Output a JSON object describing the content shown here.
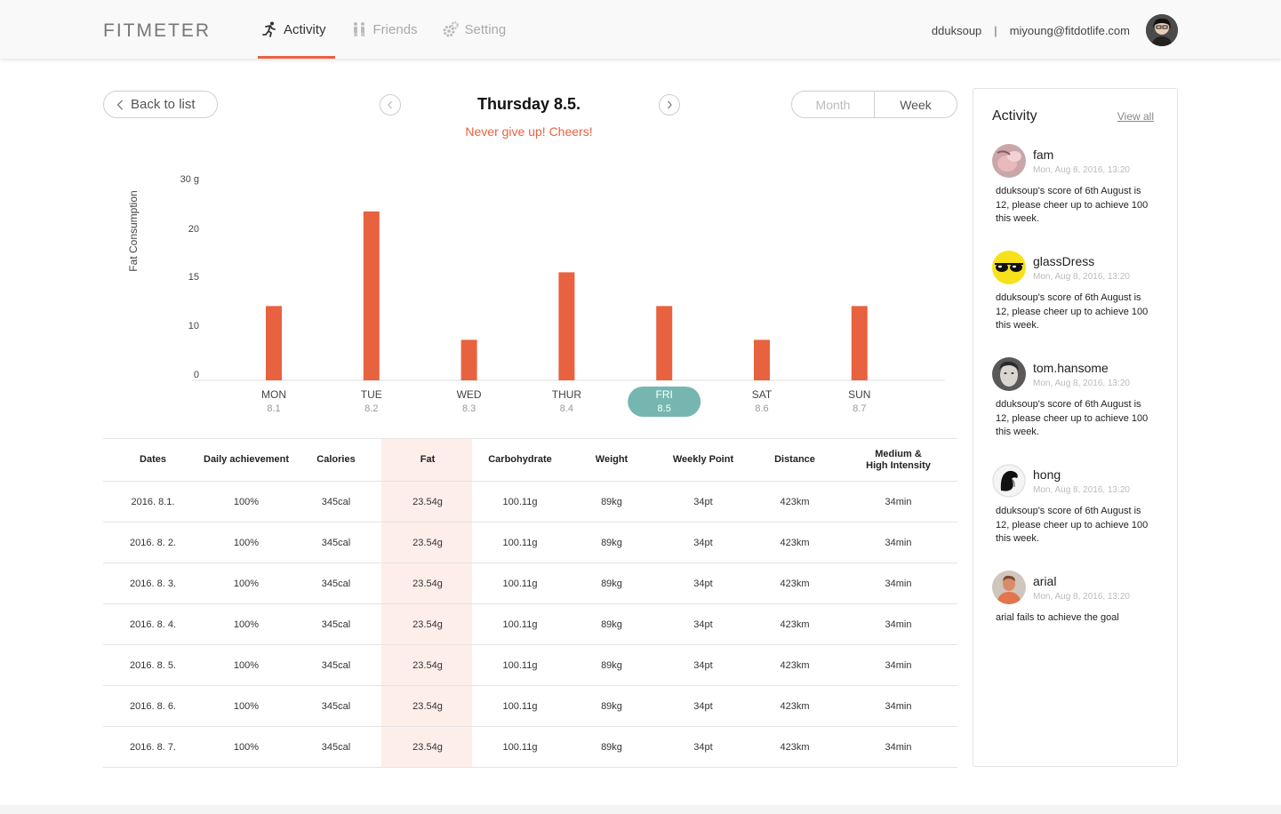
{
  "header": {
    "logo": "FITMETER",
    "nav": [
      {
        "label": "Activity",
        "icon": "runner-icon",
        "active": true
      },
      {
        "label": "Friends",
        "icon": "friends-icon",
        "active": false
      },
      {
        "label": "Setting",
        "icon": "gear-icon",
        "active": false
      }
    ],
    "username": "dduksoup",
    "separator": "|",
    "email": "miyoung@fitdotlife.com"
  },
  "controls": {
    "back_label": "Back to list",
    "date_title": "Thursday 8.5.",
    "cheer": "Never give up! Cheers!",
    "toggle": [
      "Month",
      "Week"
    ],
    "toggle_selected": "Week"
  },
  "chart_data": {
    "type": "bar",
    "ylabel": "Fat Consumption",
    "y_ticks": [
      "30 g",
      "20",
      "15",
      "10",
      "0"
    ],
    "categories": [
      "MON",
      "TUE",
      "WED",
      "THUR",
      "FRI",
      "SAT",
      "SUN"
    ],
    "dates": [
      "8.1",
      "8.2",
      "8.3",
      "8.4",
      "8.5",
      "8.6",
      "8.7"
    ],
    "values": [
      11,
      25,
      6,
      16,
      11,
      6,
      11
    ],
    "selected_index": 4,
    "bar_color": "#e86240",
    "selected_color": "#75b7b0",
    "grid": false
  },
  "table": {
    "headers": [
      "Dates",
      "Daily achievement",
      "Calories",
      "Fat",
      "Carbohydrate",
      "Weight",
      "Weekly Point",
      "Distance",
      "Medium &\nHigh Intensity"
    ],
    "rows": [
      [
        "2016. 8.1.",
        "100%",
        "345cal",
        "23.54g",
        "100.11g",
        "89kg",
        "34pt",
        "423km",
        "34min"
      ],
      [
        "2016. 8. 2.",
        "100%",
        "345cal",
        "23.54g",
        "100.11g",
        "89kg",
        "34pt",
        "423km",
        "34min"
      ],
      [
        "2016. 8. 3.",
        "100%",
        "345cal",
        "23.54g",
        "100.11g",
        "89kg",
        "34pt",
        "423km",
        "34min"
      ],
      [
        "2016. 8. 4.",
        "100%",
        "345cal",
        "23.54g",
        "100.11g",
        "89kg",
        "34pt",
        "423km",
        "34min"
      ],
      [
        "2016. 8. 5.",
        "100%",
        "345cal",
        "23.54g",
        "100.11g",
        "89kg",
        "34pt",
        "423km",
        "34min"
      ],
      [
        "2016. 8. 6.",
        "100%",
        "345cal",
        "23.54g",
        "100.11g",
        "89kg",
        "34pt",
        "423km",
        "34min"
      ],
      [
        "2016. 8. 7.",
        "100%",
        "345cal",
        "23.54g",
        "100.11g",
        "89kg",
        "34pt",
        "423km",
        "34min"
      ]
    ]
  },
  "sidebar": {
    "title": "Activity",
    "view_all": "View all",
    "items": [
      {
        "name": "fam",
        "time": "Mon, Aug 8, 2016, 13:20",
        "message": "dduksoup's score of 6th August is 12, please cheer up to achieve 100 this week.",
        "avatar": "pink-hand-avatar"
      },
      {
        "name": "glassDress",
        "time": "Mon, Aug 8, 2016, 13:20",
        "message": "dduksoup's score of 6th August is 12, please cheer up to achieve 100 this week.",
        "avatar": "glasses-avatar"
      },
      {
        "name": "tom.hansome",
        "time": "Mon, Aug 8, 2016, 13:20",
        "message": "dduksoup's score of 6th August is 12, please cheer up to achieve 100 this week.",
        "avatar": "portrait-avatar"
      },
      {
        "name": "hong",
        "time": "Mon, Aug 8, 2016, 13:20",
        "message": "dduksoup's score of 6th August is 12, please cheer up to achieve 100 this week.",
        "avatar": "profile-sketch-avatar"
      },
      {
        "name": "arial",
        "time": "Mon, Aug 8, 2016, 13:20",
        "message": "arial fails to achieve the goal",
        "avatar": "man-avatar"
      }
    ]
  }
}
